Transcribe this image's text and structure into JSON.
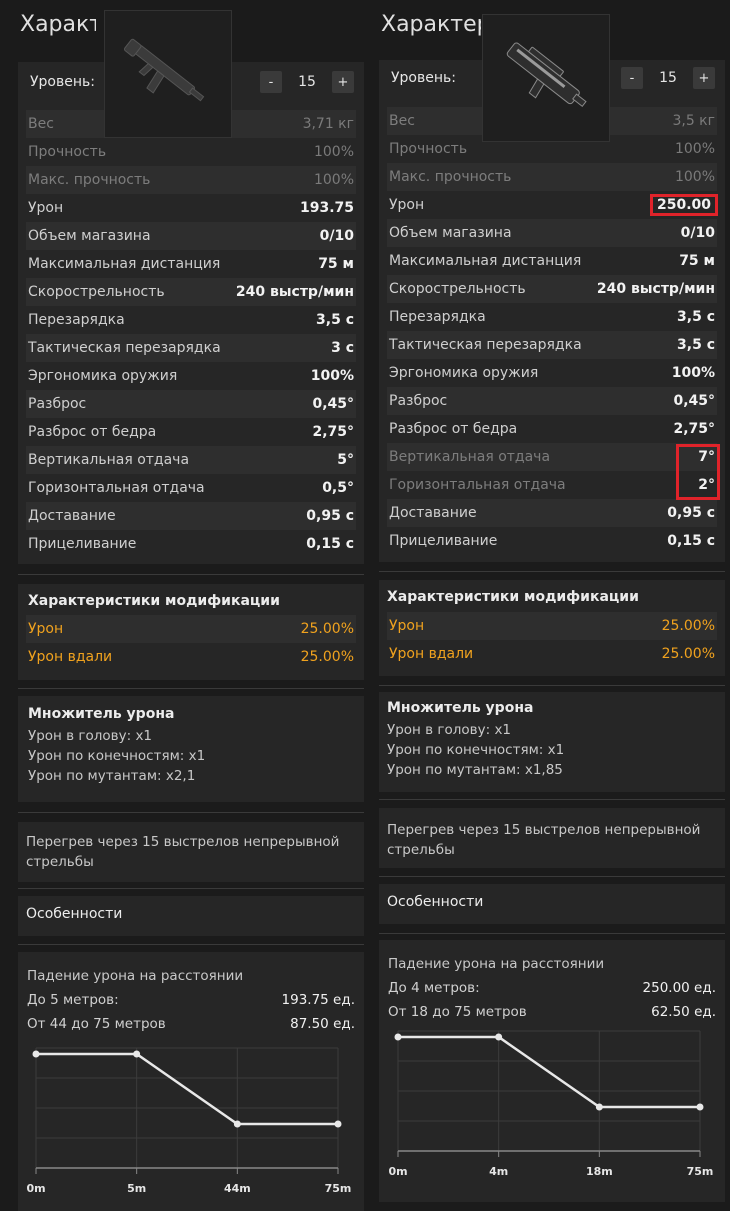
{
  "left": {
    "title": "Характеристики",
    "level_label": "Уровень:",
    "level_value": "15",
    "minus": "-",
    "plus": "+",
    "stats": [
      {
        "label": "Вес",
        "value": "3,71 кг",
        "dim": true
      },
      {
        "label": "Прочность",
        "value": "100%",
        "dim": true
      },
      {
        "label": "Макс. прочность",
        "value": "100%",
        "dim": true
      },
      {
        "label": "Урон",
        "value": "193.75"
      },
      {
        "label": "Объем магазина",
        "value": "0/10"
      },
      {
        "label": "Максимальная дистанция",
        "value": "75 м"
      },
      {
        "label": "Скорострельность",
        "value": "240 выстр/мин"
      },
      {
        "label": "Перезарядка",
        "value": "3,5 с"
      },
      {
        "label": "Тактическая перезарядка",
        "value": "3 с"
      },
      {
        "label": "Эргономика оружия",
        "value": "100%"
      },
      {
        "label": "Разброс",
        "value": "0,45°"
      },
      {
        "label": "Разброс от бедра",
        "value": "2,75°"
      },
      {
        "label": "Вертикальная отдача",
        "value": "5°"
      },
      {
        "label": "Горизонтальная отдача",
        "value": "0,5°"
      },
      {
        "label": "Доставание",
        "value": "0,95 с"
      },
      {
        "label": "Прицеливание",
        "value": "0,15 с"
      }
    ],
    "mods_title": "Характеристики модификации",
    "mods": [
      {
        "label": "Урон",
        "value": "25.00%"
      },
      {
        "label": "Урон вдали",
        "value": "25.00%"
      }
    ],
    "mult_title": "Множитель урона",
    "mult_lines": [
      "Урон в голову: x1",
      "Урон по конечностям: x1",
      "Урон по мутантам: x2,1"
    ],
    "overheat": "Перегрев через 15 выстрелов непрерывной стрельбы",
    "features_title": "Особенности",
    "falloff_title": "Падение урона на расстоянии",
    "falloff_rows": [
      {
        "label": "До 5 метров:",
        "value": "193.75 ед."
      },
      {
        "label": "От 44 до 75 метров",
        "value": "87.50 ед."
      }
    ],
    "chart_data": {
      "type": "line",
      "x": [
        0,
        5,
        44,
        75
      ],
      "y": [
        193.75,
        193.75,
        87.5,
        87.5
      ],
      "tick_labels": [
        "0m",
        "5m",
        "44m",
        "75m"
      ],
      "grid": true
    }
  },
  "right": {
    "title": "Характеристики",
    "level_label": "Уровень:",
    "level_value": "15",
    "minus": "-",
    "plus": "+",
    "stats": [
      {
        "label": "Вес",
        "value": "3,5 кг",
        "dim": true
      },
      {
        "label": "Прочность",
        "value": "100%",
        "dim": true
      },
      {
        "label": "Макс. прочность",
        "value": "100%",
        "dim": true
      },
      {
        "label": "Урон",
        "value": "250.00",
        "highlight": true
      },
      {
        "label": "Объем магазина",
        "value": "0/10"
      },
      {
        "label": "Максимальная дистанция",
        "value": "75 м"
      },
      {
        "label": "Скорострельность",
        "value": "240 выстр/мин"
      },
      {
        "label": "Перезарядка",
        "value": "3,5 с"
      },
      {
        "label": "Тактическая перезарядка",
        "value": "3,5 с"
      },
      {
        "label": "Эргономика оружия",
        "value": "100%"
      },
      {
        "label": "Разброс",
        "value": "0,45°"
      },
      {
        "label": "Разброс от бедра",
        "value": "2,75°"
      },
      {
        "label": "Вертикальная отдача",
        "value": "7°",
        "dim": true
      },
      {
        "label": "Горизонтальная отдача",
        "value": "2°",
        "dim": true
      },
      {
        "label": "Доставание",
        "value": "0,95 с"
      },
      {
        "label": "Прицеливание",
        "value": "0,15 с"
      }
    ],
    "mods_title": "Характеристики модификации",
    "mods": [
      {
        "label": "Урон",
        "value": "25.00%"
      },
      {
        "label": "Урон вдали",
        "value": "25.00%"
      }
    ],
    "mult_title": "Множитель урона",
    "mult_lines": [
      "Урон в голову: x1",
      "Урон по конечностям: x1",
      "Урон по мутантам: x1,85"
    ],
    "overheat": "Перегрев через 15 выстрелов непрерывной стрельбы",
    "features_title": "Особенности",
    "falloff_title": "Падение урона на расстоянии",
    "falloff_rows": [
      {
        "label": "До 4 метров:",
        "value": "250.00 ед."
      },
      {
        "label": "От 18 до 75 метров",
        "value": "62.50 ед."
      }
    ],
    "chart_data": {
      "type": "line",
      "x": [
        0,
        4,
        18,
        75
      ],
      "y": [
        250,
        250,
        62.5,
        62.5
      ],
      "tick_labels": [
        "0m",
        "4m",
        "18m",
        "75m"
      ],
      "grid": true
    }
  },
  "colors": {
    "highlight_box": "#e0232a",
    "mod_text": "#f0a21e",
    "panel": "#262626",
    "row_alt": "#2e2e2e"
  }
}
